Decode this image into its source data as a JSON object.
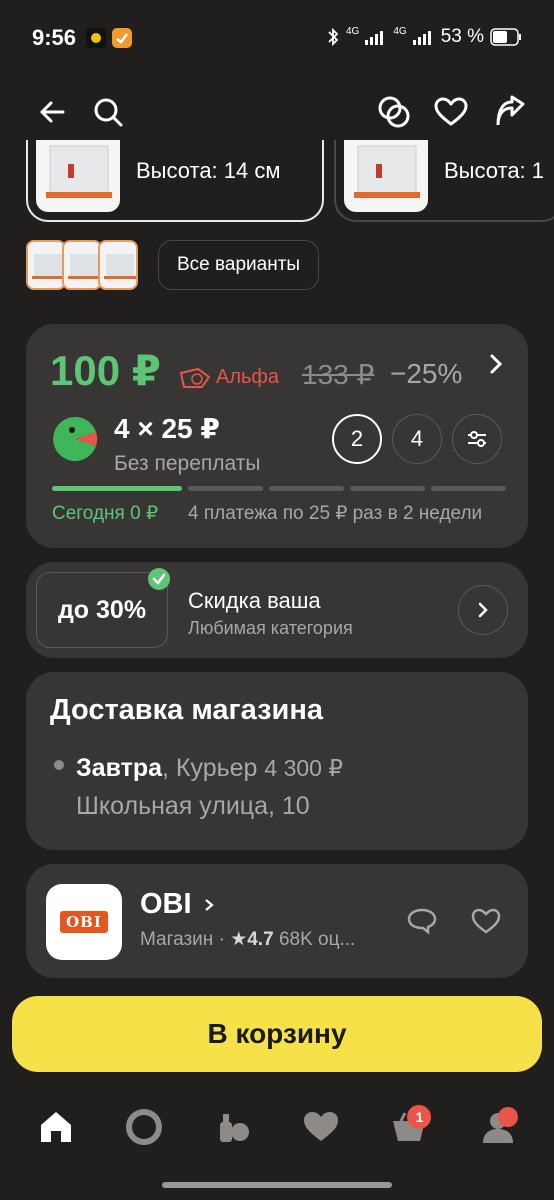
{
  "status_bar": {
    "time": "9:56",
    "net1": "4G",
    "net2": "4G",
    "battery": "53 %"
  },
  "variants": {
    "cards": [
      {
        "label": "Высота: 14 см"
      },
      {
        "label": "Высота: 1"
      }
    ],
    "all_variants_label": "Все варианты"
  },
  "price": {
    "current": "100 ₽",
    "alfa_label": "Альфа",
    "old": "133 ₽",
    "discount": "−25%",
    "split_main": "4 × 25 ₽",
    "split_sub": "Без переплаты",
    "options": [
      "2",
      "4"
    ],
    "today": "Сегодня 0 ₽",
    "payments": "4 платежа по 25 ₽ раз в 2 недели"
  },
  "discount_card": {
    "badge": "до 30%",
    "title": "Скидка ваша",
    "subtitle": "Любимая категория"
  },
  "delivery": {
    "title": "Доставка магазина",
    "when": "Завтра",
    "method": ", Курьер",
    "cost": "4 300 ₽",
    "address": "Школьная улица, 10"
  },
  "store": {
    "logo_text": "OBI",
    "name": "OBI",
    "type": "Магазин ·",
    "rating": "4.7",
    "reviews": "68K оц..."
  },
  "cta": {
    "label": "В корзину"
  },
  "bottom_nav": {
    "cart_badge": "1"
  },
  "colors": {
    "background": "#201f1e",
    "card": "#383634",
    "price_green": "#5ec576",
    "alfa_red": "#e8554a",
    "cta_yellow": "#f7e149"
  },
  "icons": [
    "back-arrow-icon",
    "search-icon",
    "compare-icon",
    "heart-icon",
    "share-icon",
    "split-logo-icon",
    "filter-icon",
    "chevron-right-icon",
    "chat-icon",
    "home-icon",
    "alice-icon",
    "catalog-icon",
    "favorites-icon",
    "cart-icon",
    "profile-icon"
  ]
}
